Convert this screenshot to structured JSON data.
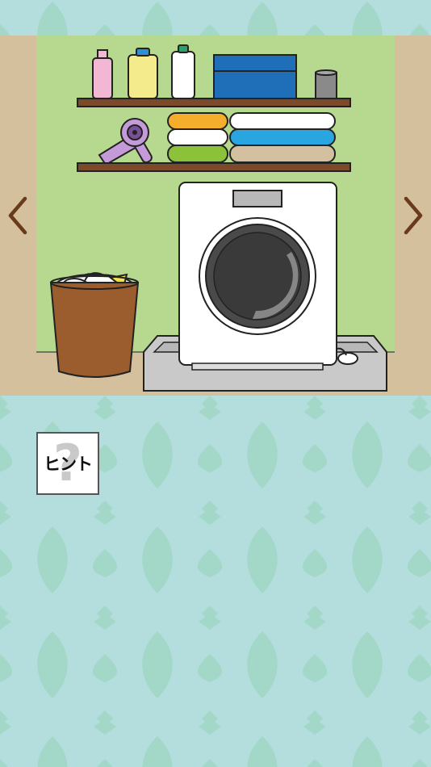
{
  "colors": {
    "background": "#b3dedd",
    "pattern": "#a3d8c9",
    "room_wall": "#b7d98f",
    "side_wall": "#d4c09c",
    "arrow": "#6b3a1c",
    "shelf": "#7a4a2a"
  },
  "icons": {
    "left": "chevron-left-icon",
    "right": "chevron-right-icon"
  },
  "hint": {
    "label": "ヒント",
    "background_glyph": "?"
  }
}
